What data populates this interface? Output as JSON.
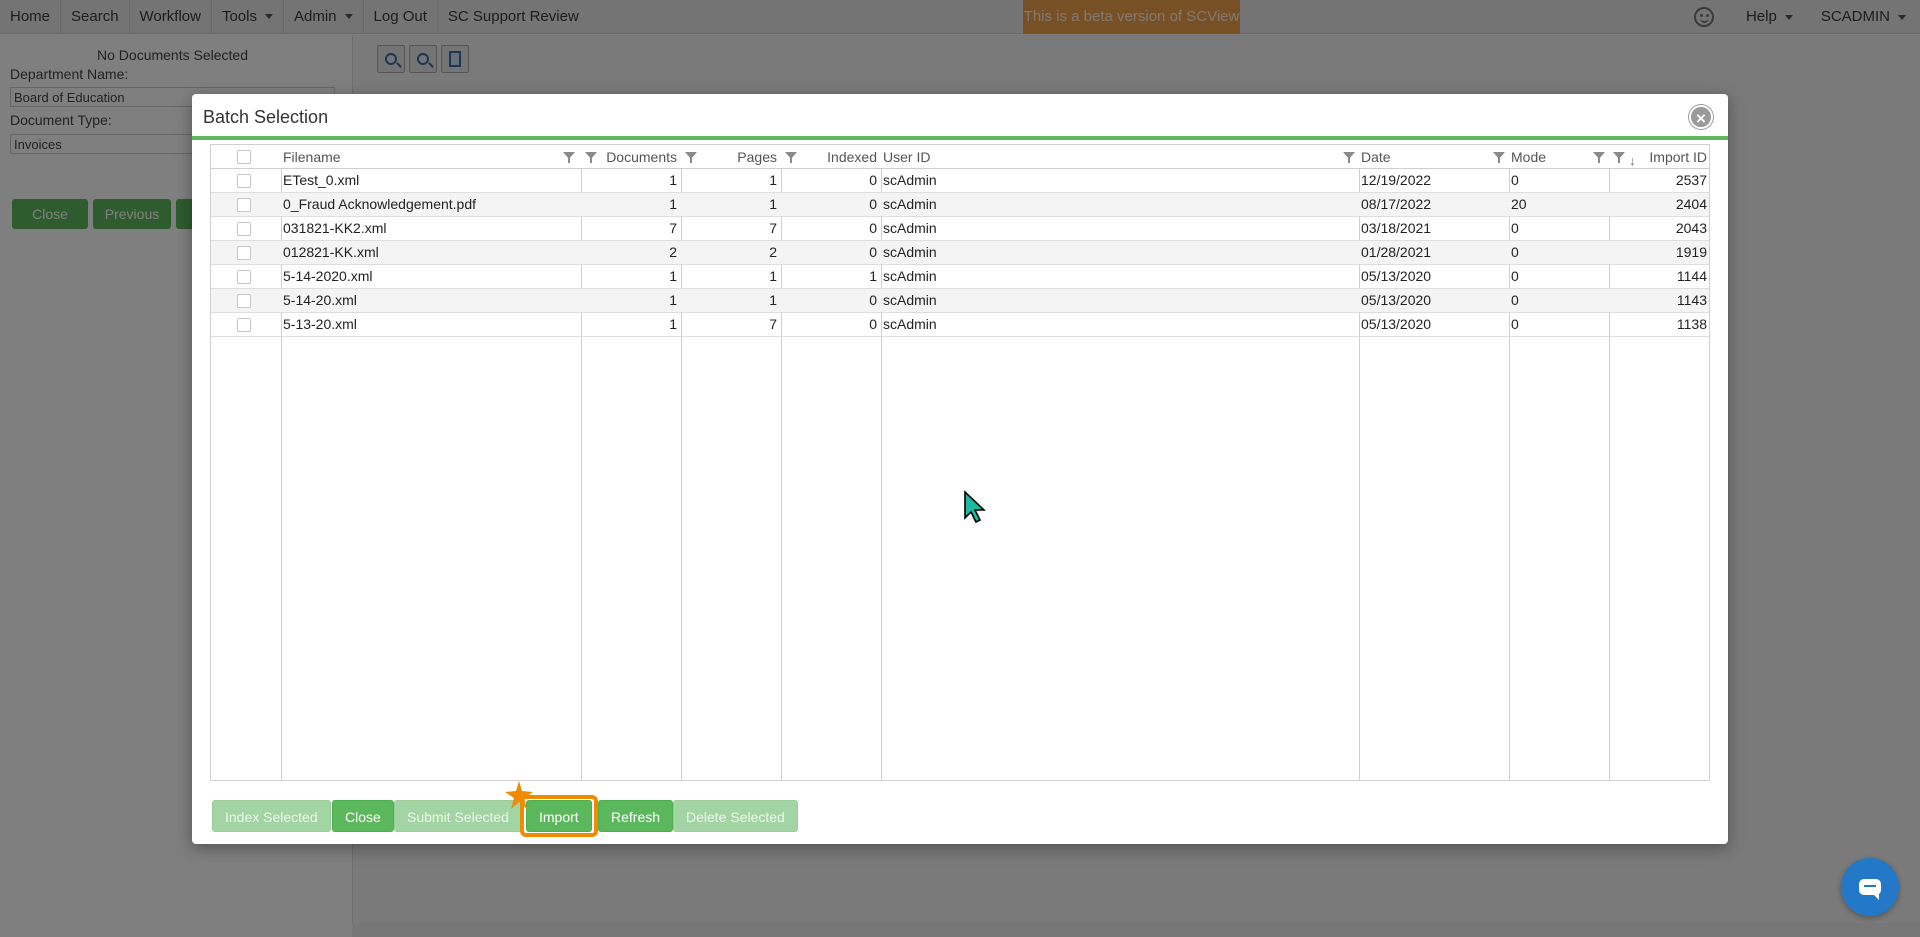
{
  "nav": {
    "items": [
      "Home",
      "Search",
      "Workflow",
      "Tools",
      "Admin",
      "Log Out",
      "SC Support Review"
    ],
    "beta_banner": "This is a beta version of SCView",
    "help": "Help",
    "user": "SCADMIN"
  },
  "left_panel": {
    "no_documents": "No Documents Selected",
    "department_label": "Department Name:",
    "department_value": "Board of Education",
    "doctype_label": "Document Type:",
    "doctype_value": "Invoices",
    "close_label": "Close",
    "previous_label": "Previous"
  },
  "viewer_toolbar": {
    "icons": [
      "zoom-in-icon",
      "zoom-out-icon",
      "page-view-icon"
    ]
  },
  "modal": {
    "title": "Batch Selection",
    "columns": {
      "filename": "Filename",
      "documents": "Documents",
      "pages": "Pages",
      "indexed": "Indexed",
      "user_id": "User ID",
      "date": "Date",
      "mode": "Mode",
      "import_id": "Import ID"
    },
    "rows": [
      {
        "filename": "ETest_0.xml",
        "documents": "1",
        "pages": "1",
        "indexed": "0",
        "user_id": "scAdmin",
        "date": "12/19/2022",
        "mode": "0",
        "import_id": "2537"
      },
      {
        "filename": "0_Fraud Acknowledgement.pdf",
        "documents": "1",
        "pages": "1",
        "indexed": "0",
        "user_id": "scAdmin",
        "date": "08/17/2022",
        "mode": "20",
        "import_id": "2404"
      },
      {
        "filename": "031821-KK2.xml",
        "documents": "7",
        "pages": "7",
        "indexed": "0",
        "user_id": "scAdmin",
        "date": "03/18/2021",
        "mode": "0",
        "import_id": "2043"
      },
      {
        "filename": "012821-KK.xml",
        "documents": "2",
        "pages": "2",
        "indexed": "0",
        "user_id": "scAdmin",
        "date": "01/28/2021",
        "mode": "0",
        "import_id": "1919"
      },
      {
        "filename": "5-14-2020.xml",
        "documents": "1",
        "pages": "1",
        "indexed": "1",
        "user_id": "scAdmin",
        "date": "05/13/2020",
        "mode": "0",
        "import_id": "1144"
      },
      {
        "filename": "5-14-20.xml",
        "documents": "1",
        "pages": "1",
        "indexed": "0",
        "user_id": "scAdmin",
        "date": "05/13/2020",
        "mode": "0",
        "import_id": "1143"
      },
      {
        "filename": "5-13-20.xml",
        "documents": "1",
        "pages": "7",
        "indexed": "0",
        "user_id": "scAdmin",
        "date": "05/13/2020",
        "mode": "0",
        "import_id": "1138"
      }
    ],
    "buttons": {
      "index_selected": "Index Selected",
      "close": "Close",
      "submit_selected": "Submit Selected",
      "import": "Import",
      "refresh": "Refresh",
      "delete_selected": "Delete Selected"
    }
  },
  "colors": {
    "accent_green": "#5cb85c",
    "beta_orange": "#f0a04b",
    "highlight_orange": "#f08a00",
    "chat_blue": "#2378c8"
  }
}
